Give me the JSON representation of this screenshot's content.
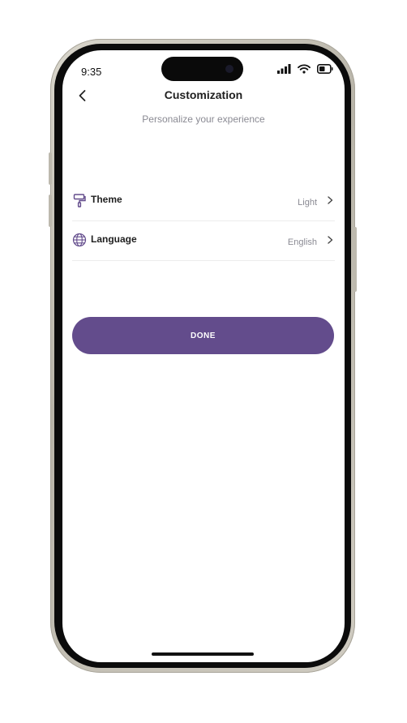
{
  "status_bar": {
    "time": "9:35"
  },
  "header": {
    "title": "Customization",
    "back_icon": "chevron-left-icon"
  },
  "subtitle": "Personalize your experience",
  "settings": [
    {
      "label": "Theme",
      "value": "Light",
      "icon": "paint-roller-icon"
    },
    {
      "label": "Language",
      "value": "English",
      "icon": "globe-icon"
    }
  ],
  "done_button": {
    "label": "DONE"
  },
  "colors": {
    "accent": "#634c8c",
    "subtle_text": "#8a8a93",
    "divider": "#ececec"
  }
}
